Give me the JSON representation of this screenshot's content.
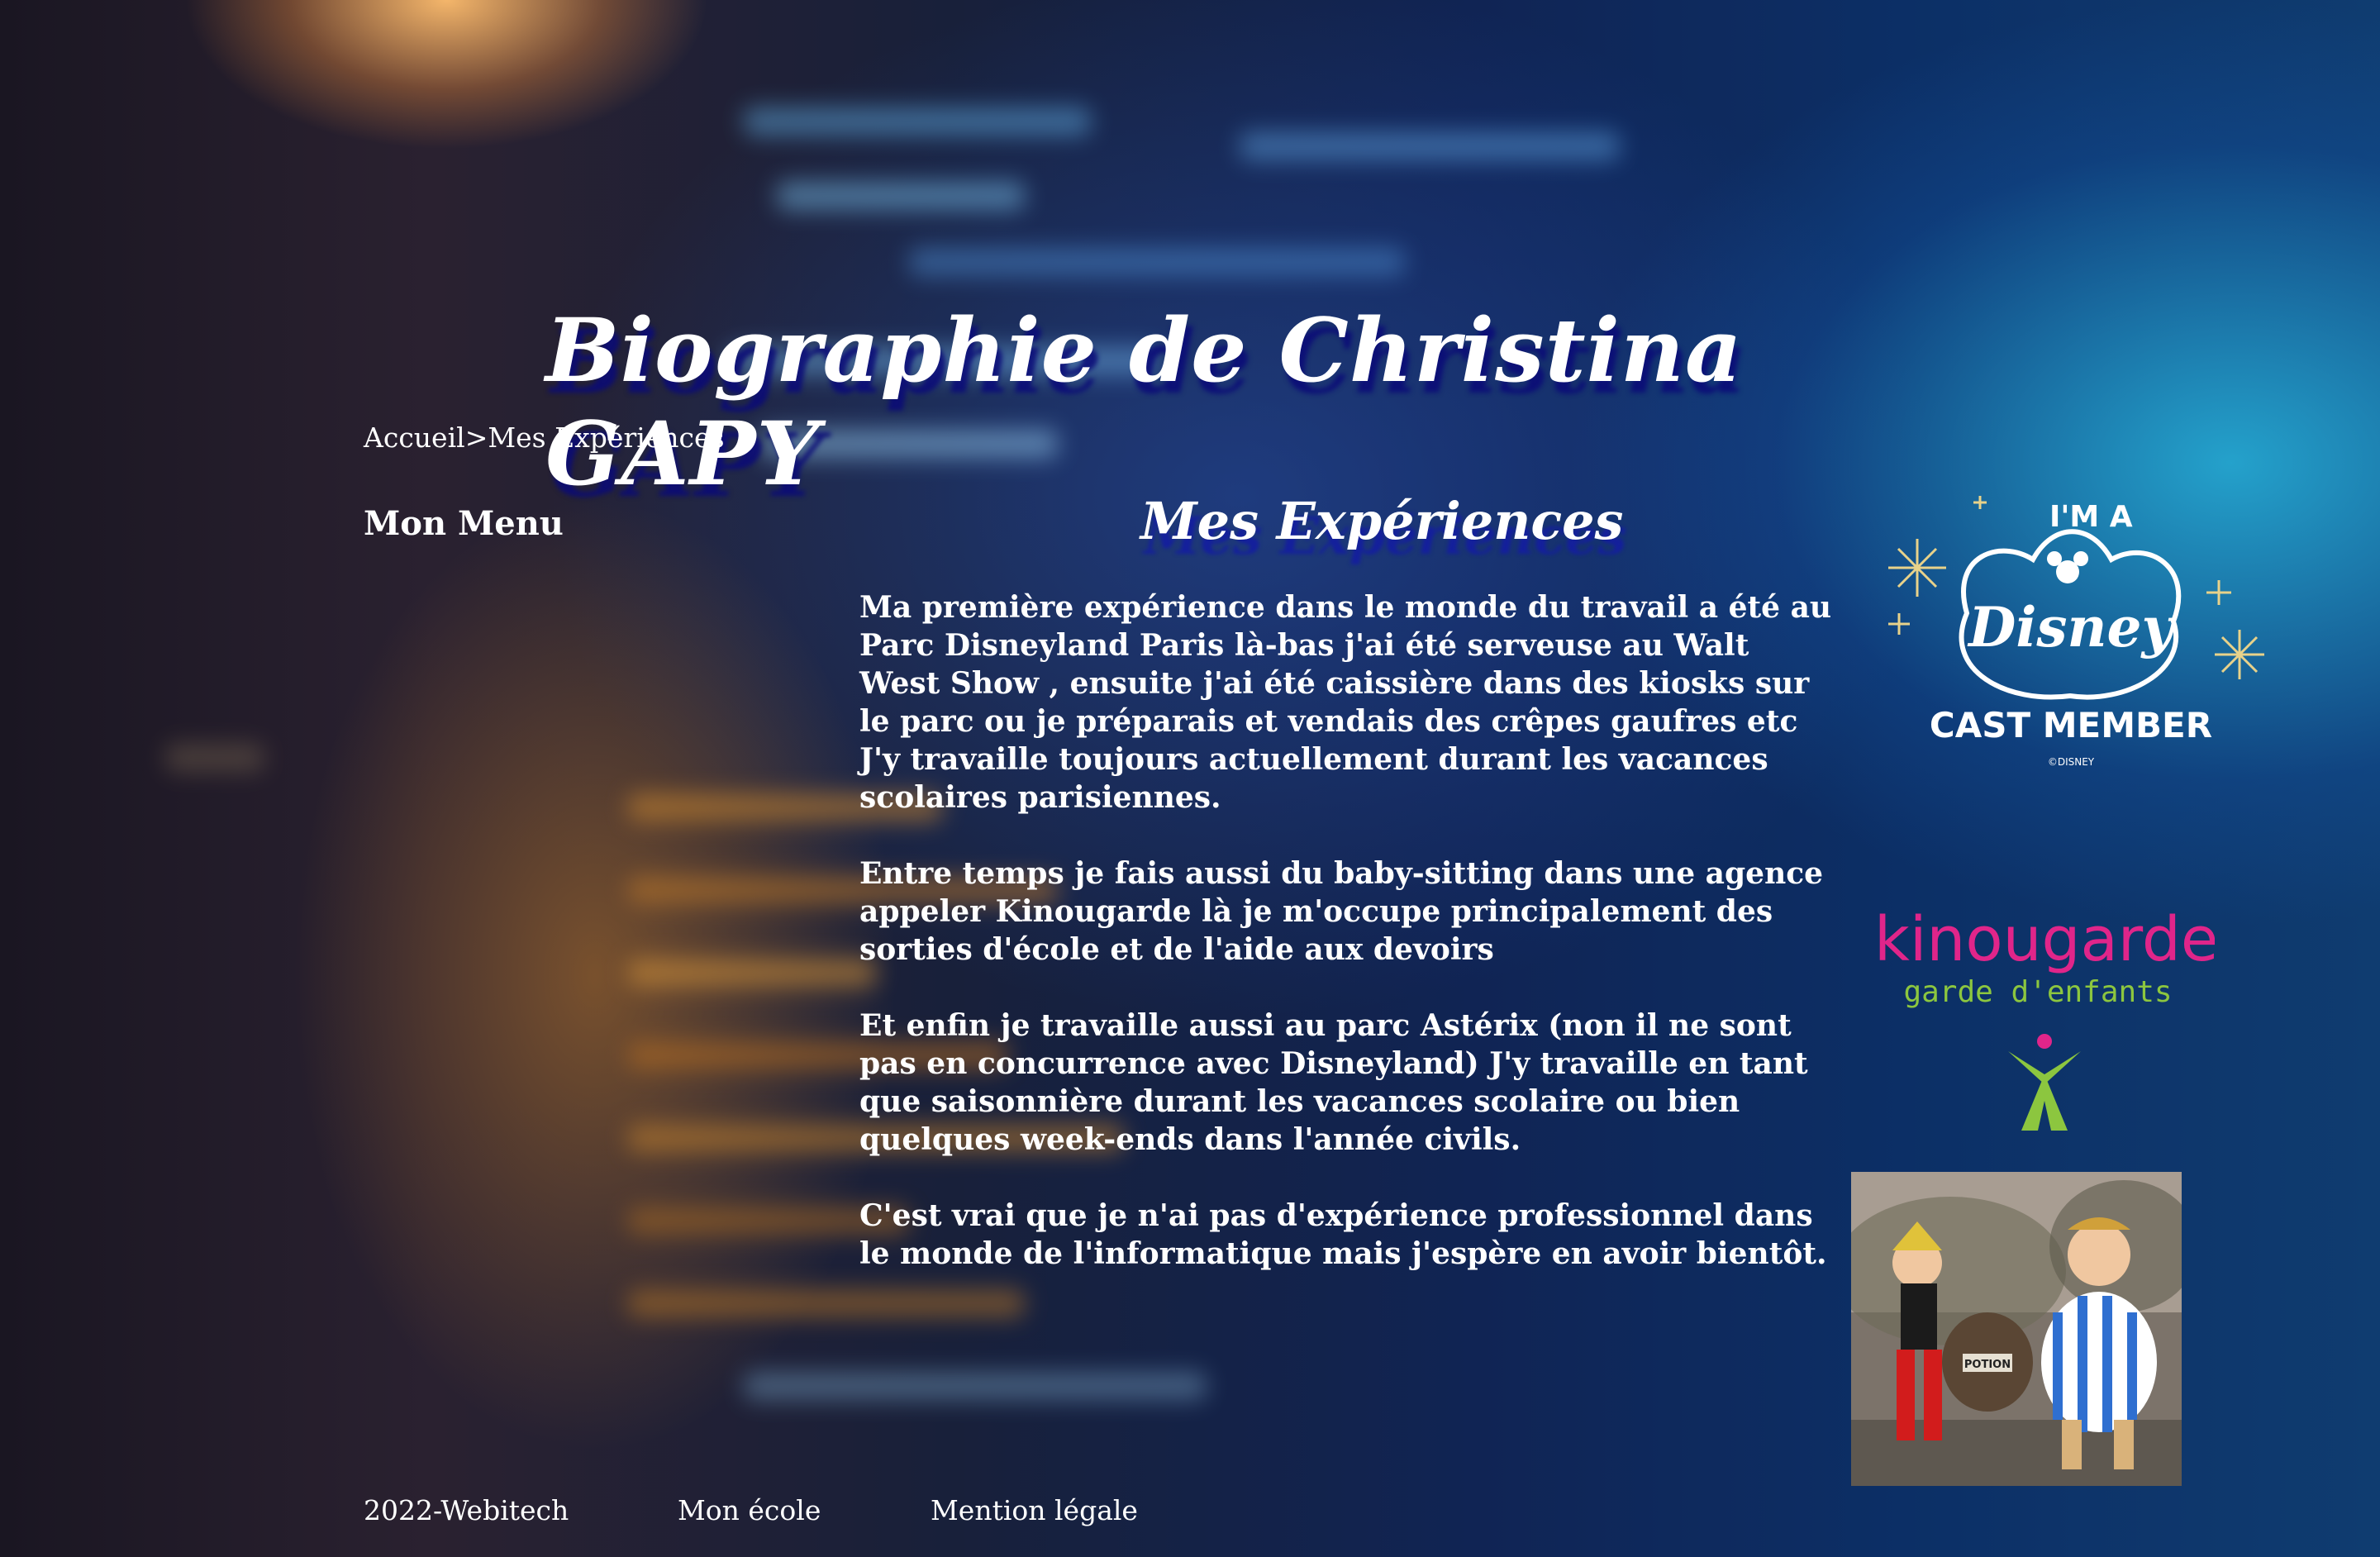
{
  "header": {
    "title": "Biographie de Christina GAPY"
  },
  "breadcrumb": {
    "home": "Accueil",
    "separator": ">",
    "current": "Mes Expériences"
  },
  "sidebar": {
    "title": "Mon Menu"
  },
  "main": {
    "heading": "Mes Expériences",
    "paragraphs": [
      "Ma première expérience dans le monde du travail a été au Parc Disneyland Paris là-bas j'ai été serveuse au Walt West Show , ensuite j'ai été caissière dans des kiosks sur le parc ou je préparais et vendais des crêpes gaufres etc",
      "J'y travaille toujours actuellement durant les vacances scolaires parisiennes.",
      "Entre temps je fais aussi du baby-sitting dans une agence appeler Kinougarde là je m'occupe principalement des sorties d'école et de l'aide aux devoirs",
      "Et enfin je travaille aussi au parc Astérix (non il ne sont pas en concurrence avec Disneyland) J'y travaille en tant que saisonnière durant les vacances scolaire ou bien quelques week-ends dans l'année civils.",
      "C'est vrai que je n'ai pas d'expérience professionnel dans le monde de l'informatique mais j'espère en avoir bientôt."
    ]
  },
  "logos": {
    "disney": {
      "top": "I'M A",
      "brand": "Disney",
      "bottom": "CAST MEMBER",
      "small": "©DISNEY",
      "color": "#ffffff"
    },
    "kinougarde": {
      "brand": "kinougarde",
      "tagline": "garde d'enfants",
      "brand_color": "#e0258a",
      "tagline_color": "#8cc63f"
    },
    "asterix_photo": {
      "sign": "POTION"
    }
  },
  "footer": {
    "copyright": "2022-Webitech",
    "school": "Mon école",
    "legal": "Mention légale"
  }
}
